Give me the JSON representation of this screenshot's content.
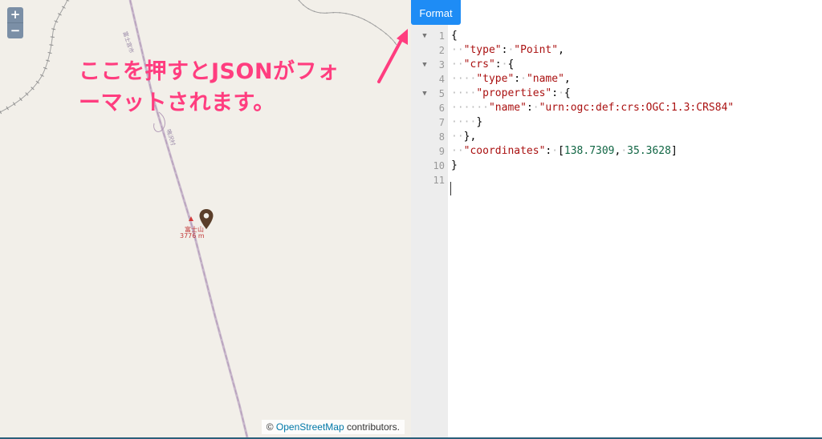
{
  "map": {
    "zoom_in_label": "+",
    "zoom_out_label": "−",
    "peak_name": "富士山",
    "peak_elevation": "3776 m",
    "road_label_1": "富士宮市",
    "road_label_2": "鳴沢村",
    "marker_icon": "map-pin-icon",
    "annotation_line1": "ここを押すとJSONがフォ",
    "annotation_line2": "ーマットされます。",
    "attribution_prefix": "©",
    "attribution_link": "OpenStreetMap",
    "attribution_suffix": "contributors.",
    "colors": {
      "background": "#f2efe9",
      "annotation": "#ff3d7f",
      "boundary": "#9a9a9a",
      "road": "#c9b8cc"
    }
  },
  "editor": {
    "format_button": "Format",
    "line_numbers": [
      "1",
      "2",
      "3",
      "4",
      "5",
      "6",
      "7",
      "8",
      "9",
      "10",
      "11"
    ],
    "foldable_lines": [
      1,
      3,
      5
    ],
    "lines": [
      "{",
      "  \"type\": \"Point\",",
      "  \"crs\": {",
      "    \"type\": \"name\",",
      "    \"properties\": {",
      "      \"name\": \"urn:ogc:def:crs:OGC:1.3:CRS84\"",
      "    }",
      "  },",
      "  \"coordinates\": [138.7309, 35.3628]",
      "}",
      ""
    ],
    "colors": {
      "button": "#1e8cf5",
      "string": "#aa1111",
      "number": "#116644",
      "gutter": "#ededed"
    }
  }
}
